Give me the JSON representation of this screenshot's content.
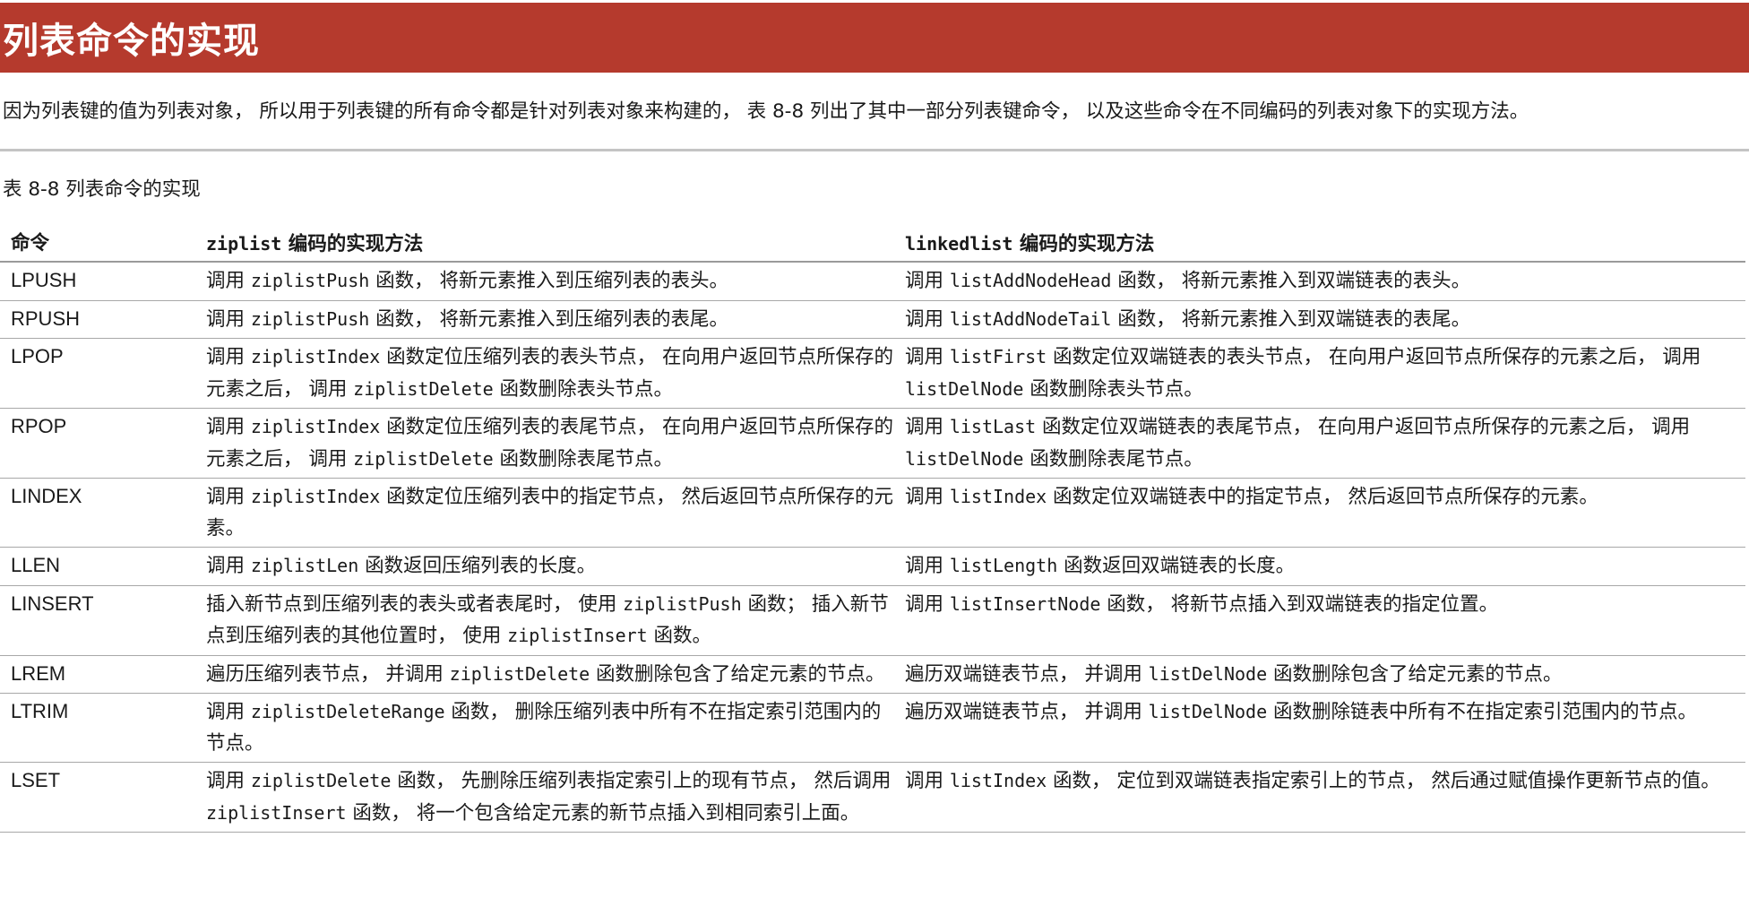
{
  "page": {
    "title": "列表命令的实现",
    "intro": "因为列表键的值为列表对象， 所以用于列表键的所有命令都是针对列表对象来构建的， 表 8-8 列出了其中一部分列表键命令， 以及这些命令在不同编码的列表对象下的实现方法。",
    "caption": "表 8-8 列表命令的实现"
  },
  "colors": {
    "title_bar": "#b53a2d",
    "title_text": "#ffffff",
    "divider": "#c4c4c4"
  },
  "table": {
    "headers": {
      "command": "命令",
      "ziplist_code": "ziplist",
      "ziplist_rest": " 编码的实现方法",
      "linkedlist_code": "linkedlist",
      "linkedlist_rest": " 编码的实现方法"
    },
    "rows": [
      {
        "command": "LPUSH",
        "ziplist": [
          {
            "t": "调用 "
          },
          {
            "c": "ziplistPush"
          },
          {
            "t": " 函数， 将新元素推入到压缩列表的表头。"
          }
        ],
        "linkedlist": [
          {
            "t": "调用 "
          },
          {
            "c": "listAddNodeHead"
          },
          {
            "t": " 函数， 将新元素推入到双端链表的表头。"
          }
        ]
      },
      {
        "command": "RPUSH",
        "ziplist": [
          {
            "t": "调用 "
          },
          {
            "c": "ziplistPush"
          },
          {
            "t": " 函数， 将新元素推入到压缩列表的表尾。"
          }
        ],
        "linkedlist": [
          {
            "t": "调用 "
          },
          {
            "c": "listAddNodeTail"
          },
          {
            "t": " 函数， 将新元素推入到双端链表的表尾。"
          }
        ]
      },
      {
        "command": "LPOP",
        "ziplist": [
          {
            "t": "调用 "
          },
          {
            "c": "ziplistIndex"
          },
          {
            "t": " 函数定位压缩列表的表头节点， 在向用户返回节点所保存的元素之后， 调用 "
          },
          {
            "c": "ziplistDelete"
          },
          {
            "t": " 函数删除表头节点。"
          }
        ],
        "linkedlist": [
          {
            "t": "调用 "
          },
          {
            "c": "listFirst"
          },
          {
            "t": " 函数定位双端链表的表头节点， 在向用户返回节点所保存的元素之后， 调用 "
          },
          {
            "c": "listDelNode"
          },
          {
            "t": " 函数删除表头节点。"
          }
        ]
      },
      {
        "command": "RPOP",
        "ziplist": [
          {
            "t": "调用 "
          },
          {
            "c": "ziplistIndex"
          },
          {
            "t": " 函数定位压缩列表的表尾节点， 在向用户返回节点所保存的元素之后， 调用 "
          },
          {
            "c": "ziplistDelete"
          },
          {
            "t": " 函数删除表尾节点。"
          }
        ],
        "linkedlist": [
          {
            "t": "调用 "
          },
          {
            "c": "listLast"
          },
          {
            "t": " 函数定位双端链表的表尾节点， 在向用户返回节点所保存的元素之后， 调用 "
          },
          {
            "c": "listDelNode"
          },
          {
            "t": " 函数删除表尾节点。"
          }
        ]
      },
      {
        "command": "LINDEX",
        "ziplist": [
          {
            "t": "调用 "
          },
          {
            "c": "ziplistIndex"
          },
          {
            "t": " 函数定位压缩列表中的指定节点， 然后返回节点所保存的元素。"
          }
        ],
        "linkedlist": [
          {
            "t": "调用 "
          },
          {
            "c": "listIndex"
          },
          {
            "t": " 函数定位双端链表中的指定节点， 然后返回节点所保存的元素。"
          }
        ]
      },
      {
        "command": "LLEN",
        "ziplist": [
          {
            "t": "调用 "
          },
          {
            "c": "ziplistLen"
          },
          {
            "t": " 函数返回压缩列表的长度。"
          }
        ],
        "linkedlist": [
          {
            "t": "调用 "
          },
          {
            "c": "listLength"
          },
          {
            "t": " 函数返回双端链表的长度。"
          }
        ]
      },
      {
        "command": "LINSERT",
        "ziplist": [
          {
            "t": "插入新节点到压缩列表的表头或者表尾时， 使用 "
          },
          {
            "c": "ziplistPush"
          },
          {
            "t": " 函数； 插入新节点到压缩列表的其他位置时， 使用 "
          },
          {
            "c": "ziplistInsert"
          },
          {
            "t": " 函数。"
          }
        ],
        "linkedlist": [
          {
            "t": "调用 "
          },
          {
            "c": "listInsertNode"
          },
          {
            "t": " 函数， 将新节点插入到双端链表的指定位置。"
          }
        ]
      },
      {
        "command": "LREM",
        "ziplist": [
          {
            "t": "遍历压缩列表节点， 并调用 "
          },
          {
            "c": "ziplistDelete"
          },
          {
            "t": " 函数删除包含了给定元素的节点。"
          }
        ],
        "linkedlist": [
          {
            "t": "遍历双端链表节点， 并调用 "
          },
          {
            "c": "listDelNode"
          },
          {
            "t": " 函数删除包含了给定元素的节点。"
          }
        ]
      },
      {
        "command": "LTRIM",
        "ziplist": [
          {
            "t": "调用 "
          },
          {
            "c": "ziplistDeleteRange"
          },
          {
            "t": " 函数， 删除压缩列表中所有不在指定索引范围内的节点。"
          }
        ],
        "linkedlist": [
          {
            "t": "遍历双端链表节点， 并调用 "
          },
          {
            "c": "listDelNode"
          },
          {
            "t": " 函数删除链表中所有不在指定索引范围内的节点。"
          }
        ]
      },
      {
        "command": "LSET",
        "ziplist": [
          {
            "t": "调用 "
          },
          {
            "c": "ziplistDelete"
          },
          {
            "t": " 函数， 先删除压缩列表指定索引上的现有节点， 然后调用 "
          },
          {
            "c": "ziplistInsert"
          },
          {
            "t": " 函数， 将一个包含给定元素的新节点插入到相同索引上面。"
          }
        ],
        "linkedlist": [
          {
            "t": "调用 "
          },
          {
            "c": "listIndex"
          },
          {
            "t": " 函数， 定位到双端链表指定索引上的节点， 然后通过赋值操作更新节点的值。"
          }
        ]
      }
    ]
  }
}
